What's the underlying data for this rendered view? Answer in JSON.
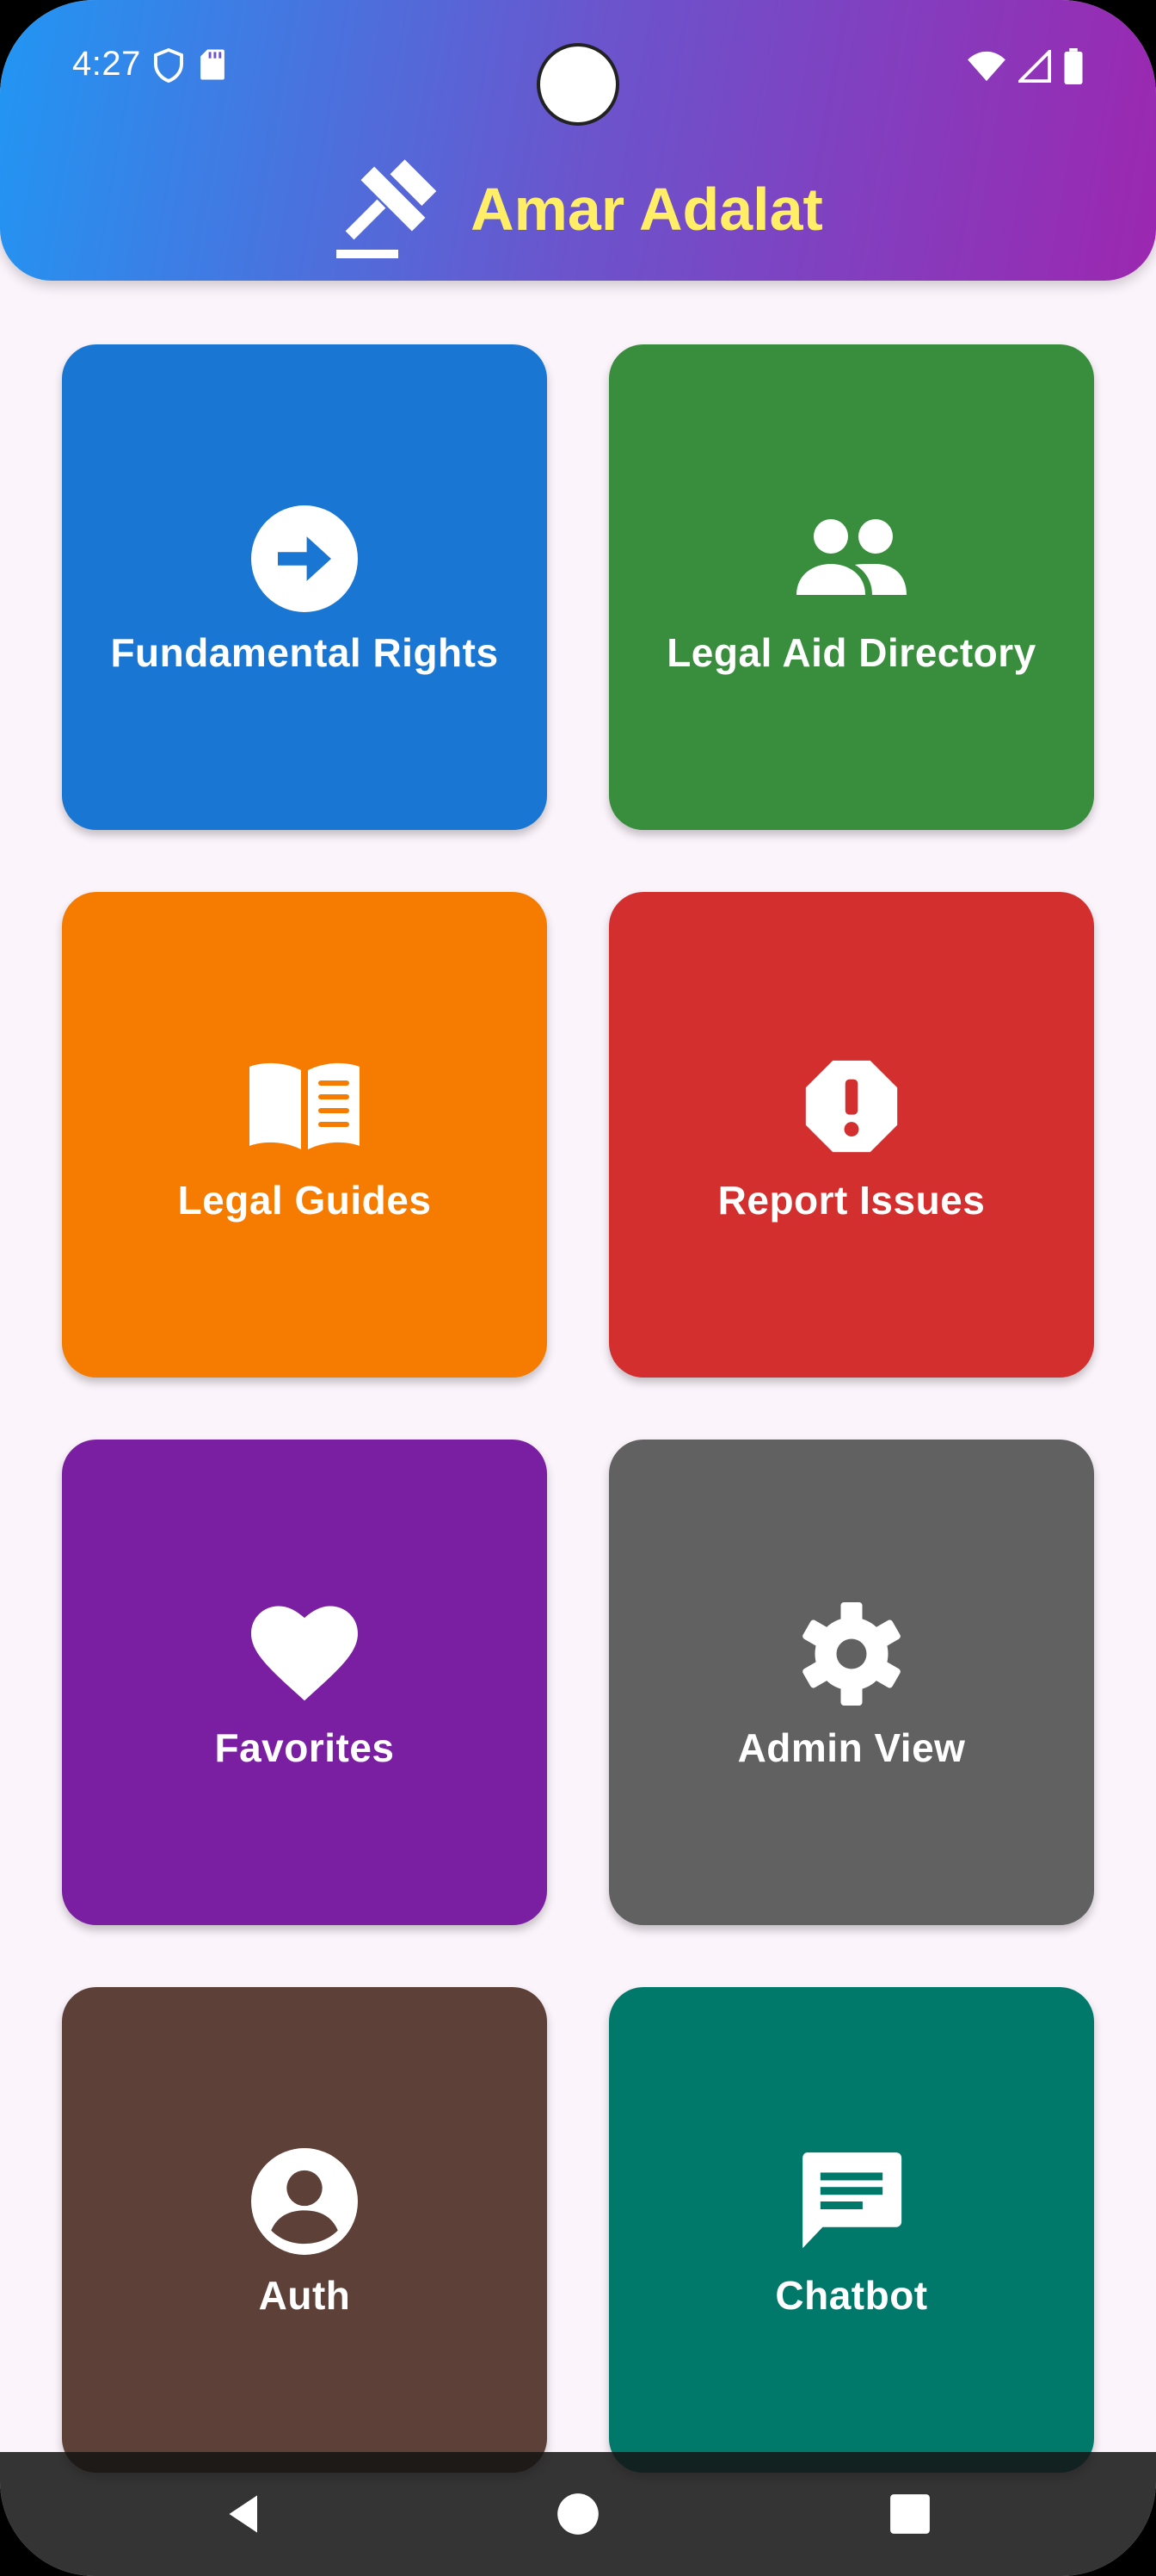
{
  "status_bar": {
    "time": "4:27",
    "icons": [
      "shield-icon",
      "sd-card-icon",
      "wifi-icon",
      "signal-icon",
      "battery-icon"
    ]
  },
  "app_bar": {
    "title": "Amar Adalat",
    "logo_icon": "gavel-icon",
    "title_color": "#ffee66",
    "gradient": [
      "#2196f3",
      "#9c27b0"
    ]
  },
  "tiles": [
    {
      "label": "Fundamental Rights",
      "icon": "arrow-circle-right-icon",
      "color": "#1976d2"
    },
    {
      "label": "Legal Aid Directory",
      "icon": "people-icon",
      "color": "#388e3c"
    },
    {
      "label": "Legal Guides",
      "icon": "menu-book-icon",
      "color": "#f57c00"
    },
    {
      "label": "Report Issues",
      "icon": "report-icon",
      "color": "#d32f2f"
    },
    {
      "label": "Favorites",
      "icon": "heart-icon",
      "color": "#7b1fa2"
    },
    {
      "label": "Admin View",
      "icon": "settings-icon",
      "color": "#616161"
    },
    {
      "label": "Auth",
      "icon": "account-circle-icon",
      "color": "#5d4037"
    },
    {
      "label": "Chatbot",
      "icon": "chat-icon",
      "color": "#00796b"
    }
  ],
  "nav_bar": {
    "buttons": [
      "back-icon",
      "home-icon",
      "recents-icon"
    ]
  }
}
